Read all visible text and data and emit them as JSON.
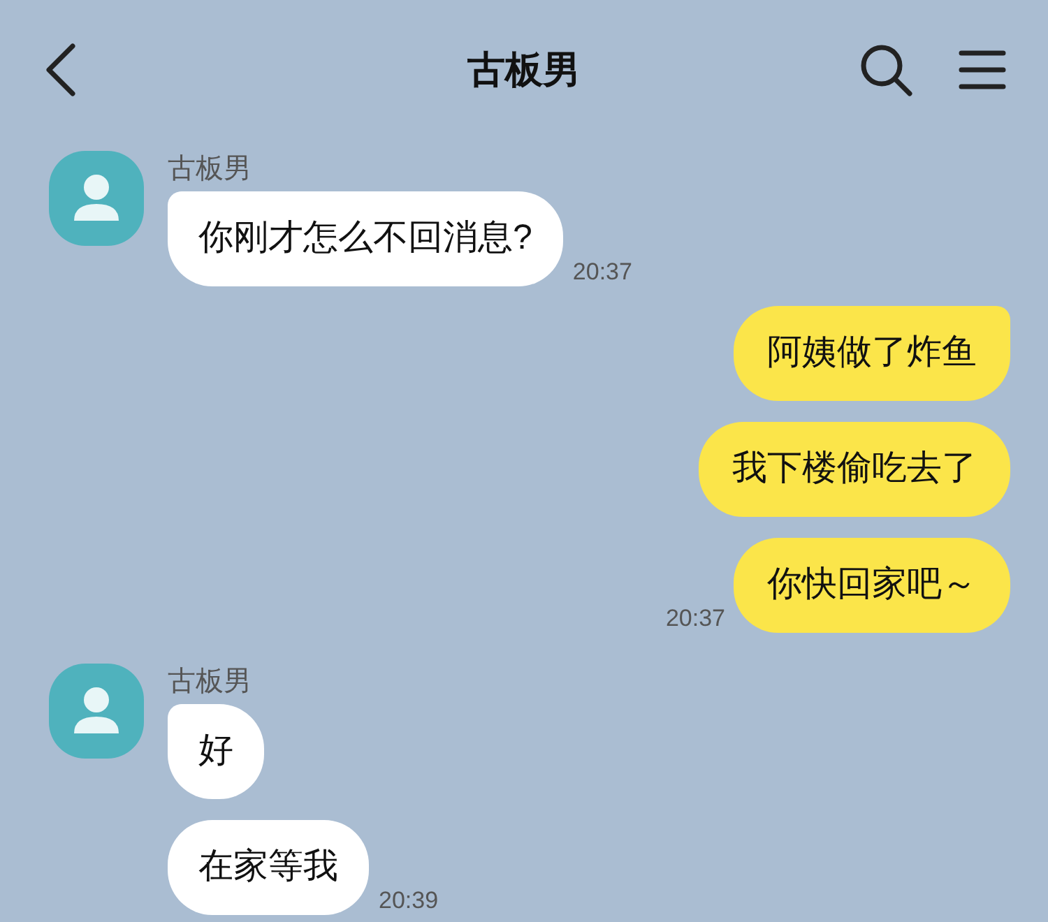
{
  "header": {
    "title": "古板男"
  },
  "messages": [
    {
      "kind": "received",
      "sender": "古板男",
      "bubbles": [
        "你刚才怎么不回消息?"
      ],
      "time": "20:37"
    },
    {
      "kind": "sent",
      "bubbles": [
        "阿姨做了炸鱼",
        "我下楼偷吃去了",
        "你快回家吧～"
      ],
      "time": "20:37"
    },
    {
      "kind": "received",
      "sender": "古板男",
      "bubbles": [
        "好",
        "在家等我"
      ],
      "time": "20:39"
    }
  ]
}
